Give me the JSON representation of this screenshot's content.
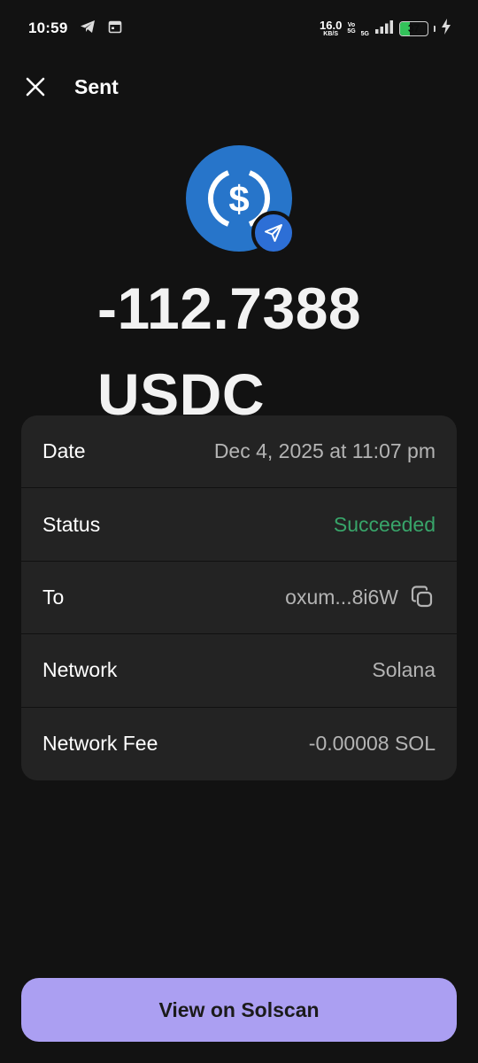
{
  "status_bar": {
    "time": "10:59",
    "net_speed": "16.0",
    "net_speed_unit": "KB/S",
    "volte_top": "Vo",
    "volte_bottom": "5G",
    "network_type": "5G",
    "battery_level": "37",
    "battery_fraction": 0.37,
    "icons": [
      "telegram-icon",
      "calendar-icon",
      "signal-icon",
      "battery-icon",
      "charging-icon"
    ]
  },
  "header": {
    "title": "Sent",
    "close_icon": "close-icon"
  },
  "token": {
    "icon": "usdc-icon",
    "badge_icon": "send-arrow-icon",
    "brand_color": "#2775ca"
  },
  "amount": {
    "value": "-112.7388",
    "symbol": "USDC"
  },
  "details": [
    {
      "label": "Date",
      "value": "Dec 4, 2025 at 11:07 pm"
    },
    {
      "label": "Status",
      "value": "Succeeded",
      "status_color": "#38a56a"
    },
    {
      "label": "To",
      "value": "oxum...8i6W",
      "action_icon": "copy-icon"
    },
    {
      "label": "Network",
      "value": "Solana"
    },
    {
      "label": "Network Fee",
      "value": "-0.00008 SOL"
    }
  ],
  "footer": {
    "button_label": "View on Solscan",
    "button_color": "#ab9ff2"
  }
}
